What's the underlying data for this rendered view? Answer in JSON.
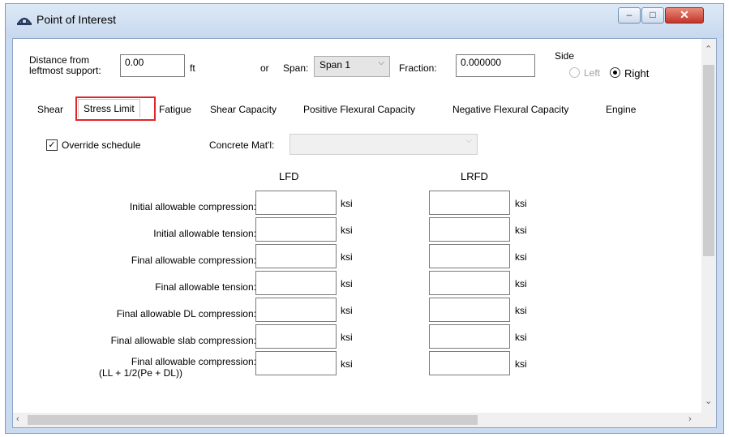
{
  "window": {
    "title": "Point of Interest",
    "controls": {
      "minimize": "–",
      "maximize": "□",
      "close": "✕"
    }
  },
  "location": {
    "distance_label_line1": "Distance from",
    "distance_label_line2": "leftmost support:",
    "distance_value": "0.00",
    "distance_unit": "ft",
    "or_label": "or",
    "span_label": "Span:",
    "span_value": "Span 1",
    "fraction_label": "Fraction:",
    "fraction_value": "0.000000",
    "side_label": "Side",
    "side_left": "Left",
    "side_right": "Right",
    "side_selected": "Right"
  },
  "tabs": [
    {
      "label": "Shear"
    },
    {
      "label": "Stress Limit",
      "active": true
    },
    {
      "label": "Fatigue"
    },
    {
      "label": "Shear Capacity"
    },
    {
      "label": "Positive Flexural Capacity"
    },
    {
      "label": "Negative Flexural Capacity"
    },
    {
      "label": "Engine"
    }
  ],
  "stress_limit": {
    "override_label": "Override schedule",
    "override_checked": true,
    "concrete_label": "Concrete Mat'l:",
    "concrete_value": "",
    "col_lfd": "LFD",
    "col_lrfd": "LRFD",
    "unit": "ksi",
    "rows": [
      {
        "label": "Initial allowable compression:",
        "lfd": "",
        "lrfd": ""
      },
      {
        "label": "Initial allowable tension:",
        "lfd": "",
        "lrfd": ""
      },
      {
        "label": "Final allowable compression:",
        "lfd": "",
        "lrfd": ""
      },
      {
        "label": "Final allowable tension:",
        "lfd": "",
        "lrfd": ""
      },
      {
        "label": "Final allowable DL compression:",
        "lfd": "",
        "lrfd": ""
      },
      {
        "label": "Final allowable slab compression:",
        "lfd": "",
        "lrfd": ""
      },
      {
        "label": "Final allowable compression:",
        "label2": "(LL + 1/2(Pe + DL))",
        "lfd": "",
        "lrfd": ""
      }
    ]
  },
  "colors": {
    "highlight": "#e0242a",
    "titlebar": "#c9daf1"
  }
}
